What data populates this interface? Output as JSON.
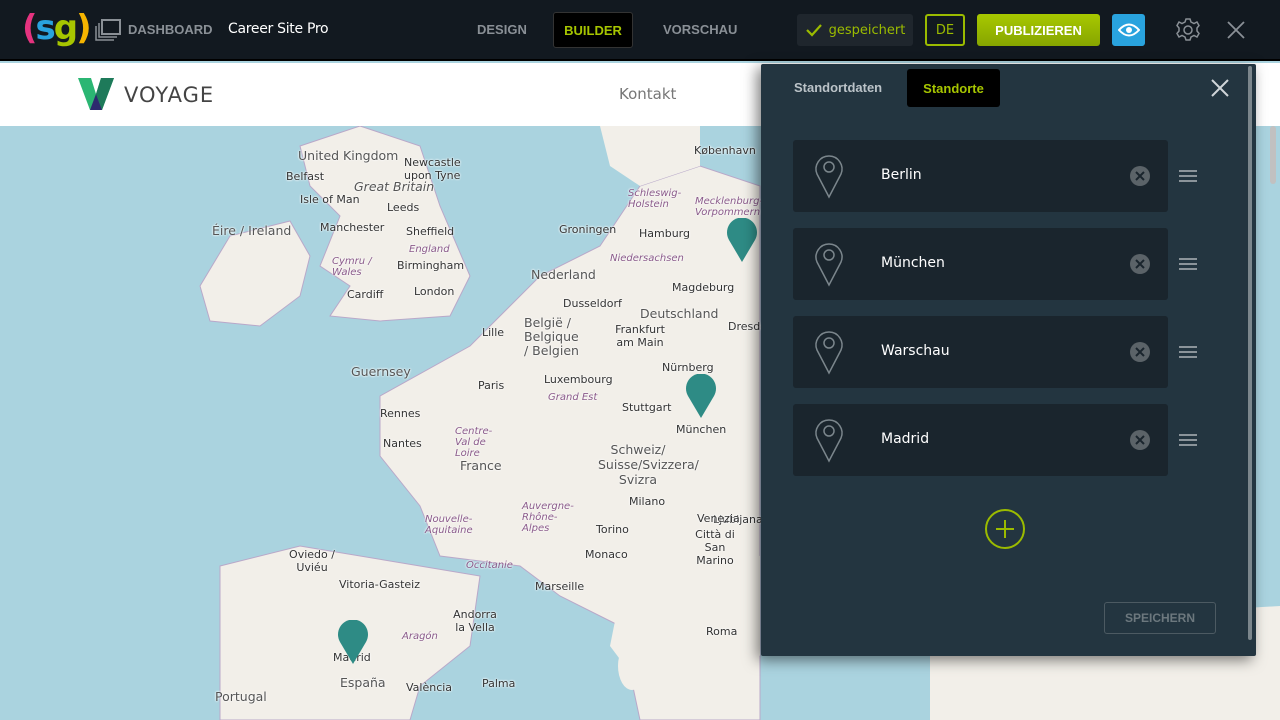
{
  "topbar": {
    "logo": "(sg)",
    "dashboard": "DASHBOARD",
    "site_title": "Career Site Pro",
    "tabs": [
      "DESIGN",
      "BUILDER",
      "VORSCHAU"
    ],
    "active_tab": "BUILDER",
    "saved": "gespeichert",
    "language": "DE",
    "publish": "PUBLIZIEREN",
    "icons": [
      "dashboard-icon",
      "check-icon",
      "eye-icon",
      "gear-icon",
      "close-icon"
    ]
  },
  "site": {
    "brand": "VOYAGE",
    "nav": [
      "Kontakt"
    ]
  },
  "panel": {
    "tabs": [
      "Standortdaten",
      "Standorte"
    ],
    "active_tab": "Standorte",
    "locations": [
      "Berlin",
      "München",
      "Warschau",
      "Madrid"
    ],
    "save": "SPEICHERN",
    "colors": {
      "accent": "#a6c500",
      "panel": "#233540",
      "pin": "#2e8b85"
    }
  },
  "map": {
    "labels": [
      "United Kingdom",
      "Newcastle upon Tyne",
      "Belfast",
      "Great Britain",
      "Isle of Man",
      "Leeds",
      "Éire / Ireland",
      "Manchester",
      "Sheffield",
      "England",
      "Cymru / Wales",
      "Birmingham",
      "Cardiff",
      "London",
      "København",
      "Schleswig-Holstein",
      "Mecklenburg-Vorpommern",
      "Groningen",
      "Hamburg",
      "Nederland",
      "Niedersachsen",
      "Magdeburg",
      "Lille",
      "Dusseldorf",
      "België / Belgique / Belgien",
      "Frankfurt am Main",
      "Deutschland",
      "Dresden",
      "Guernsey",
      "Paris",
      "Luxembourg",
      "Nürnberg",
      "Grand Est",
      "Stuttgart",
      "Rennes",
      "Centre-Val de Loire",
      "München",
      "Nantes",
      "France",
      "Schweiz/ Suisse/Svizzera/ Svizra",
      "Ljubljana",
      "Milano",
      "Venezia",
      "Nouvelle-Aquitaine",
      "Auvergne-Rhône-Alpes",
      "Torino",
      "Città di San Marino",
      "Oviedo / Uviéu",
      "Occitanie",
      "Monaco",
      "Vitoria-Gasteiz",
      "Marseille",
      "Andorra la Vella",
      "Aragón",
      "Roma",
      "Madrid",
      "España",
      "València",
      "Palma",
      "Portugal"
    ]
  }
}
